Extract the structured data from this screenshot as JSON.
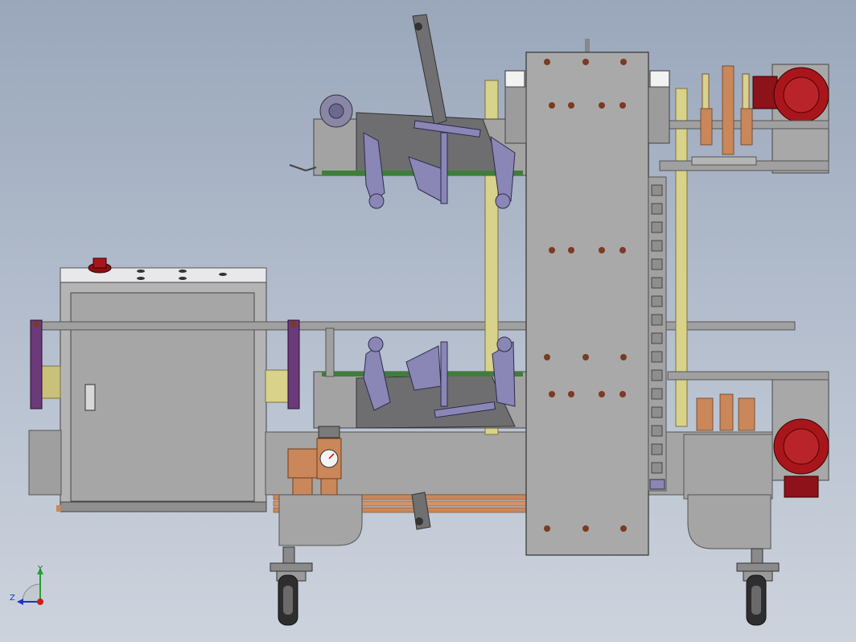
{
  "viewport": {
    "background_top": "#9aa7bb",
    "background_bottom": "#cdd3dd"
  },
  "model": {
    "name": "",
    "colors": {
      "frame": "#a9a9a9",
      "frame_dark": "#7d7d7d",
      "plate_dark": "#6e6e70",
      "linkage": "#7c76a6",
      "rod_yellow": "#d8d28a",
      "motor_red": "#a8161c",
      "copper": "#c9875a",
      "bolt": "#7a3b22",
      "rail_purple": "#6b3a7a",
      "green_belt": "#3f7d3a"
    },
    "components": [
      "main-column",
      "electrical-cabinet",
      "upper-taping-head",
      "lower-taping-head",
      "upper-drive-motor",
      "lower-drive-motor",
      "air-filter-regulator",
      "left-caster-wheel",
      "right-caster-wheel",
      "cable-chain"
    ]
  },
  "triad": {
    "x_label": "",
    "y_label": "Y",
    "z_label": "Z",
    "x_color": "#d11a1a",
    "y_color": "#1fa32a",
    "z_color": "#1a34c9"
  }
}
